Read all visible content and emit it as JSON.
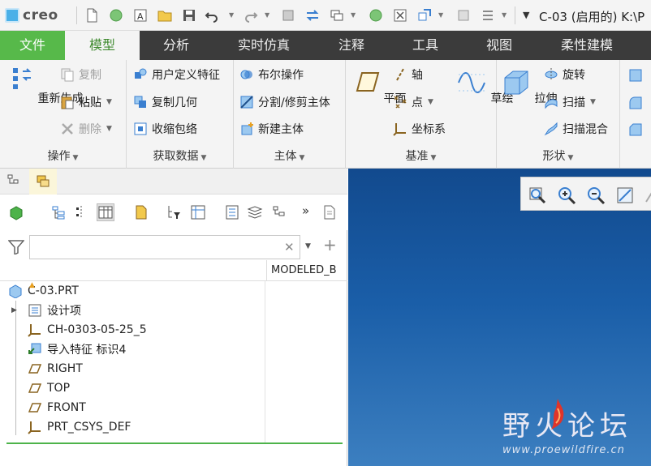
{
  "app": {
    "logo_text": "creo",
    "window_title": "C-03 (启用的) K:\\P"
  },
  "tabs": [
    {
      "label": "文件"
    },
    {
      "label": "模型"
    },
    {
      "label": "分析"
    },
    {
      "label": "实时仿真"
    },
    {
      "label": "注释"
    },
    {
      "label": "工具"
    },
    {
      "label": "视图"
    },
    {
      "label": "柔性建模"
    }
  ],
  "ribbon": {
    "operations": {
      "label": "操作",
      "regenerate": "重新生成",
      "copy": "复制",
      "paste": "粘贴",
      "delete": "删除"
    },
    "get_data": {
      "label": "获取数据",
      "udf": "用户定义特征",
      "copy_geometry": "复制几何",
      "shrinkwrap": "收缩包络"
    },
    "body": {
      "label": "主体",
      "boolean": "布尔操作",
      "split_trim": "分割/修剪主体",
      "new_body": "新建主体"
    },
    "datum": {
      "label": "基准",
      "plane": "平面",
      "axis": "轴",
      "point": "点",
      "csys": "坐标系",
      "sketch": "草绘"
    },
    "shapes": {
      "label": "形状",
      "extrude": "拉伸",
      "revolve": "旋转",
      "sweep": "扫描",
      "swept_blend": "扫描混合"
    }
  },
  "model_tree": {
    "search_value": "",
    "column_header": "MODELED_B",
    "items": [
      {
        "label": "C-03.PRT"
      },
      {
        "label": "设计项"
      },
      {
        "label": "CH-0303-05-25_5"
      },
      {
        "label": "导入特征 标识4"
      },
      {
        "label": "RIGHT"
      },
      {
        "label": "TOP"
      },
      {
        "label": "FRONT"
      },
      {
        "label": "PRT_CSYS_DEF"
      }
    ]
  },
  "watermark": {
    "title": "野火论坛",
    "url": "www.proewildfire.cn"
  },
  "colors": {
    "file_tab": "#57b94a",
    "active_tab_text": "#3f8a2f",
    "tab_bar": "#3b3b3b",
    "viewport": "#124a8e"
  }
}
